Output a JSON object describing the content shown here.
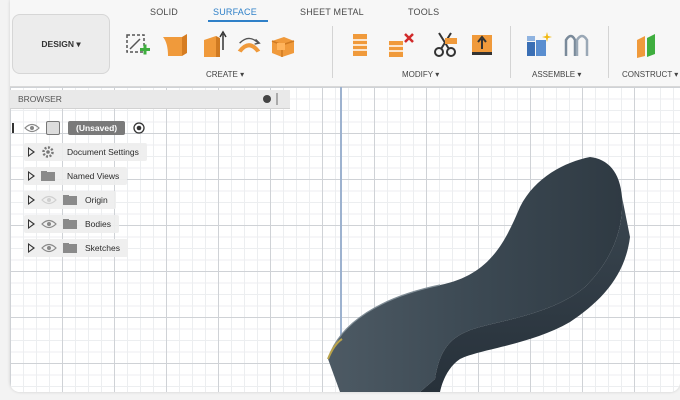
{
  "workspace": {
    "label": "DESIGN ▾"
  },
  "tabs": [
    {
      "label": "SOLID"
    },
    {
      "label": "SURFACE"
    },
    {
      "label": "SHEET METAL"
    },
    {
      "label": "TOOLS"
    }
  ],
  "active_tab": "SURFACE",
  "groups": {
    "create": "CREATE ▾",
    "modify": "MODIFY ▾",
    "assemble": "ASSEMBLE ▾",
    "construct": "CONSTRUCT ▾"
  },
  "tools": {
    "create": [
      "create-sketch-icon",
      "patch-icon",
      "extrude-icon",
      "revolve-icon",
      "loft-icon"
    ],
    "modify": [
      "trim-icon",
      "delete-face-icon",
      "split-body-icon",
      "extend-icon"
    ],
    "assemble": [
      "new-component-icon",
      "joint-icon"
    ],
    "construct": [
      "offset-plane-icon"
    ]
  },
  "browser": {
    "title": "BROWSER",
    "root": "(Unsaved)",
    "items": [
      {
        "label": "Document Settings",
        "icon": "gear-icon",
        "visible": false
      },
      {
        "label": "Named Views",
        "icon": "folder-icon",
        "visible": false
      },
      {
        "label": "Origin",
        "icon": "folder-icon",
        "visible": true,
        "eye_dim": true
      },
      {
        "label": "Bodies",
        "icon": "folder-icon",
        "visible": true
      },
      {
        "label": "Sketches",
        "icon": "folder-icon",
        "visible": true
      }
    ]
  },
  "colors": {
    "accent": "#2f80c8",
    "body": "#3c4953",
    "tool_orange": "#f09a3b"
  }
}
